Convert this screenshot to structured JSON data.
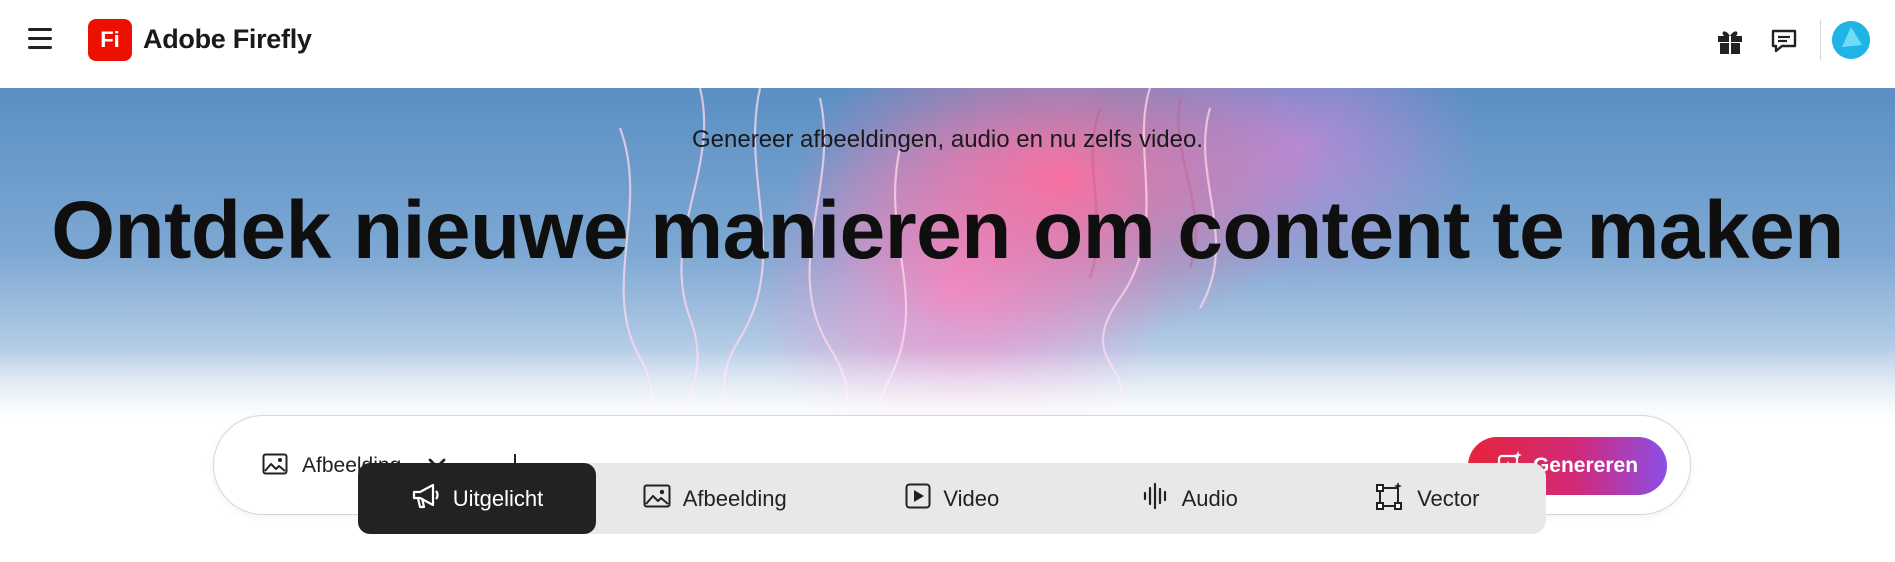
{
  "header": {
    "logo_text": "Fi",
    "brand": "Adobe Firefly",
    "icons": [
      "menu-icon",
      "gift-icon",
      "chat-icon",
      "avatar"
    ]
  },
  "hero": {
    "subtitle": "Genereer afbeeldingen, audio en nu zelfs video.",
    "headline": "Ontdek nieuwe manieren om content te maken"
  },
  "prompt": {
    "type_label": "Afbeelding",
    "input_value": "",
    "generate_label": "Genereren"
  },
  "tabs": [
    {
      "label": "Uitgelicht",
      "icon": "megaphone-icon",
      "active": true
    },
    {
      "label": "Afbeelding",
      "icon": "image-icon",
      "active": false
    },
    {
      "label": "Video",
      "icon": "play-icon",
      "active": false
    },
    {
      "label": "Audio",
      "icon": "waveform-icon",
      "active": false
    },
    {
      "label": "Vector",
      "icon": "vector-icon",
      "active": false
    }
  ],
  "colors": {
    "brand_red": "#eb1000",
    "active_tab": "#222222",
    "generate_gradient_start": "#e6243a",
    "generate_gradient_end": "#8a4fe6",
    "avatar": "#1fb4e6"
  }
}
